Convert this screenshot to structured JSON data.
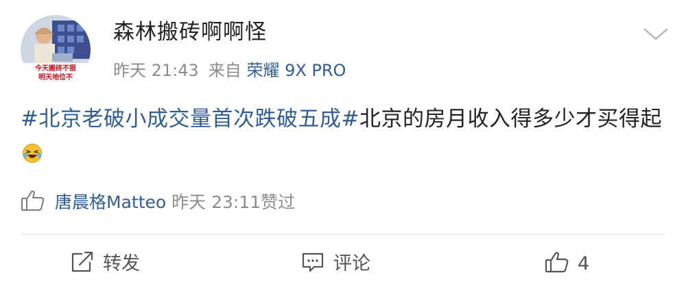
{
  "post": {
    "author": {
      "name": "森林搬砖啊啊怪",
      "avatar_caption_line1": "今天搬砖不狠",
      "avatar_caption_line2": "明天地位不"
    },
    "time": "昨天 21:43",
    "source_prefix": "来自",
    "device": "荣耀 9X PRO",
    "content": {
      "hashtag": "#北京老破小成交量首次跌破五成#",
      "text": "北京的房月收入得多少才买得起",
      "emoji_icon": "laughing-crying-emoji-icon"
    },
    "liked_by": {
      "icon": "thumbs-up-icon",
      "user": "唐晨格Matteo",
      "time_text": "昨天 23:11赞过"
    },
    "actions": {
      "repost_label": "转发",
      "comment_label": "评论",
      "like_count": "4"
    },
    "colors": {
      "link": "#2f5d9a",
      "meta": "#8c8c8c",
      "text": "#222222",
      "emoji": "#f6c12e"
    }
  }
}
